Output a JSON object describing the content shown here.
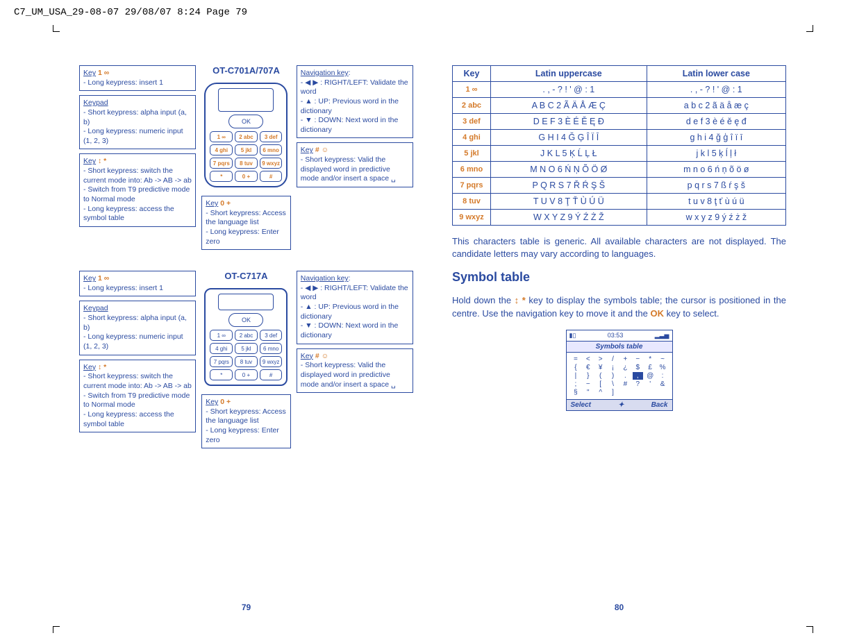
{
  "header_meta": "C7_UM_USA_29-08-07  29/08/07  8:24  Page 79",
  "page_left_num": "79",
  "page_right_num": "80",
  "diagram1_title": "OT-C701A/707A",
  "diagram2_title": "OT-C717A",
  "callouts": {
    "key1": {
      "label": "Key",
      "glyph": "1 ∞",
      "items": [
        "Long keypress: insert 1"
      ]
    },
    "keypad": {
      "label": "Keypad",
      "items": [
        "Short keypress: alpha input (a, b)",
        "Long keypress: numeric input (1, 2, 3)"
      ]
    },
    "keyMode": {
      "label": "Key",
      "glyph": "↕ *",
      "items": [
        "Short keypress: switch the current mode into: Ab -> AB -> ab",
        "Switch from T9 predictive mode to Normal mode",
        "Long keypress: access the symbol table"
      ]
    },
    "navkey": {
      "label": "Navigation key",
      "items": [
        "◀ ▶ : RIGHT/LEFT: Validate the word",
        "▲ : UP: Previous word in the dictionary",
        "▼ : DOWN: Next word in the dictionary"
      ]
    },
    "keyHash": {
      "label": "Key",
      "glyph": "# ☺",
      "items": [
        "Short keypress: Valid the displayed word in predictive mode and/or insert a space ␣"
      ]
    },
    "key0": {
      "label": "Key",
      "glyph": "0 +",
      "items": [
        "Short keypress: Access the language list",
        "Long keypress: Enter zero"
      ]
    }
  },
  "phone_nav_label": "OK",
  "phone_keys": [
    "1 ∞",
    "2 abc",
    "3 def",
    "4 ghi",
    "5 jkl",
    "6 mno",
    "7 pqrs",
    "8 tuv",
    "9 wxyz",
    "*",
    "0 +",
    "#"
  ],
  "char_table": {
    "headers": [
      "Key",
      "Latin uppercase",
      "Latin lower case"
    ],
    "rows": [
      {
        "key": "1 ∞",
        "upper": ". , - ? ! ' @ : 1",
        "lower": ". , - ? ! ' @ : 1"
      },
      {
        "key": "2 abc",
        "upper": "A B C 2 Ã Ä Å Æ Ç",
        "lower": "a b c 2 ã ä å æ ç"
      },
      {
        "key": "3 def",
        "upper": "D E F 3 È É Ě Ę Đ",
        "lower": "d e f 3 è é ě ę đ"
      },
      {
        "key": "4 ghi",
        "upper": "G H I 4 Ğ Ģ Î Ï Ī",
        "lower": "g h i 4 ğ ģ î ï ī"
      },
      {
        "key": "5 jkl",
        "upper": "J K L 5 Ķ Ĺ Ļ Ł",
        "lower": "j k l 5 ķ ĺ ļ ł"
      },
      {
        "key": "6 mno",
        "upper": "M N O 6 Ń Ņ Õ Ö Ø",
        "lower": "m n o 6 ń ņ õ ö ø"
      },
      {
        "key": "7 pqrs",
        "upper": "P Q R S 7 Ř Ŕ Ş Š",
        "lower": "p q r s 7 ß ŕ ş š"
      },
      {
        "key": "8 tuv",
        "upper": "T U V 8 Ţ Ť Ù Ú Ü",
        "lower": "t u v 8 ţ ť ù ú ü"
      },
      {
        "key": "9 wxyz",
        "upper": "W X Y Z 9 Ý Ź Ż Ž",
        "lower": "w x y z 9 ý ź ż ž"
      }
    ]
  },
  "char_note": "This characters table is generic. All available characters are not displayed. The candidate letters may vary according to languages.",
  "symbol_heading": "Symbol table",
  "symbol_text_pre": "Hold down the ",
  "symbol_text_key": "↕ *",
  "symbol_text_mid": " key to display the symbols table; the cursor is positioned in the centre. Use the navigation key to move it and the ",
  "symbol_text_ok": "OK",
  "symbol_text_post": " key to select.",
  "screenshot": {
    "time": "03:53",
    "title": "Symbols table",
    "grid": [
      "=",
      "<",
      ">",
      "/",
      "+",
      "−",
      "*",
      "~",
      "{",
      "€",
      "¥",
      "¡",
      "¿",
      "$",
      "£",
      "%",
      "|",
      "}",
      "(",
      ")",
      ".",
      ",",
      "@",
      ":",
      ";",
      "−",
      "[",
      "\\",
      "#",
      "?",
      "'",
      "&",
      "§",
      "\"",
      "^",
      "]"
    ],
    "grid_highlight_index": 21,
    "soft_left": "Select",
    "soft_right": "Back"
  }
}
